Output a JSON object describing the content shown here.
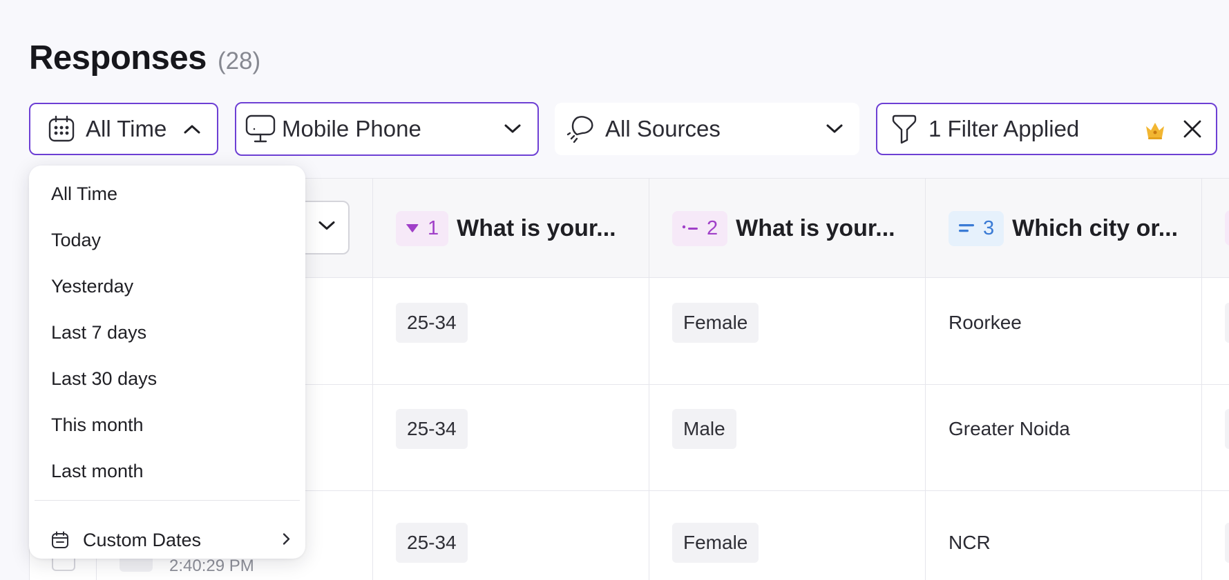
{
  "header": {
    "title": "Responses",
    "count": "(28)"
  },
  "filters": {
    "time": {
      "label": "All Time",
      "icon": "calendar-icon",
      "state": "expanded"
    },
    "device": {
      "label": "Mobile Phone",
      "icon": "monitor-icon"
    },
    "source": {
      "label": "All Sources",
      "icon": "source-icon"
    },
    "applied": {
      "label": "1 Filter Applied",
      "icon": "funnel-icon",
      "premium_icon": "crown-icon"
    }
  },
  "colors": {
    "accent": "#6d3fd4",
    "crown": "#f2b632",
    "badge_purple": "#a03fc8",
    "badge_blue": "#3a7bd5"
  },
  "time_menu": {
    "items": [
      "All Time",
      "Today",
      "Yesterday",
      "Last 7 days",
      "Last 30 days",
      "This month",
      "Last month"
    ],
    "custom_label": "Custom Dates"
  },
  "table": {
    "columns": [
      {
        "num": "1",
        "text": "What is your...",
        "icon": "dropdown-type-icon"
      },
      {
        "num": "2",
        "text": "What is your...",
        "icon": "choice-type-icon"
      },
      {
        "num": "3",
        "text": "Which city or...",
        "icon": "text-type-icon"
      }
    ],
    "rows": [
      {
        "age": "25-34",
        "gender": "Female",
        "city": "Roorkee"
      },
      {
        "age": "25-34",
        "gender": "Male",
        "city": "Greater Noida"
      },
      {
        "age": "25-34",
        "gender": "Female",
        "city": "NCR",
        "time": "2:40:29 PM"
      }
    ]
  }
}
